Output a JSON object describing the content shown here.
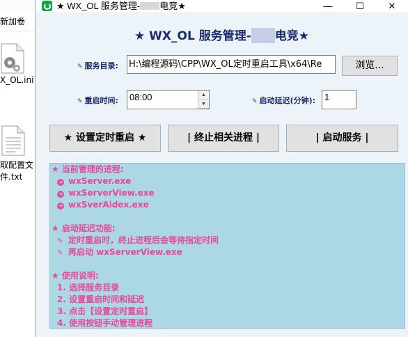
{
  "desktop": {
    "new_folder_label": "新加卷",
    "ini_file_label": "X_OL.ini",
    "txt_file_label": "取配置文件.txt"
  },
  "window": {
    "title_prefix": "★ WX_OL 服务管理-",
    "title_suffix": "电竞★",
    "minimize": "—",
    "maximize": "☐",
    "close": "✕"
  },
  "header": {
    "prefix": "★ WX_OL 服务管理-",
    "suffix": "电竞★"
  },
  "form": {
    "service_dir_label": "服务目录:",
    "service_dir_value": "H:\\编程源码\\CPP\\WX_OL定时重启工具\\x64\\Re",
    "browse_label": "浏览...",
    "restart_time_label": "重启时间:",
    "restart_time_value": "08:00",
    "startup_delay_label": "启动延迟(分钟):",
    "startup_delay_value": "1"
  },
  "actions": {
    "set_schedule": "★ 设置定时重启 ★",
    "terminate": "| 终止相关进程 |",
    "start_service": "| 启动服务 |"
  },
  "info": {
    "processes_title": "★ 当前管理的进程:",
    "processes": [
      "wxServer.exe",
      "wxServerView.exe",
      "wxSverAidex.exe"
    ],
    "delay_title": "★ 启动延迟功能:",
    "delay_items": [
      "定时重启时，终止进程后会等待指定时间",
      "再启动 wxServerView.exe"
    ],
    "usage_title": "★ 使用说明:",
    "usage_items": [
      "1. 选择服务目录",
      "2. 设置重启时间和延迟",
      "3. 点击【设置定时重启】",
      "4. 使用按钮手动管理进程"
    ]
  },
  "colors": {
    "header_text": "#1a2a6c",
    "info_background": "#acd8e6",
    "info_text": "#e8489a",
    "window_background": "#ecf4f9"
  }
}
